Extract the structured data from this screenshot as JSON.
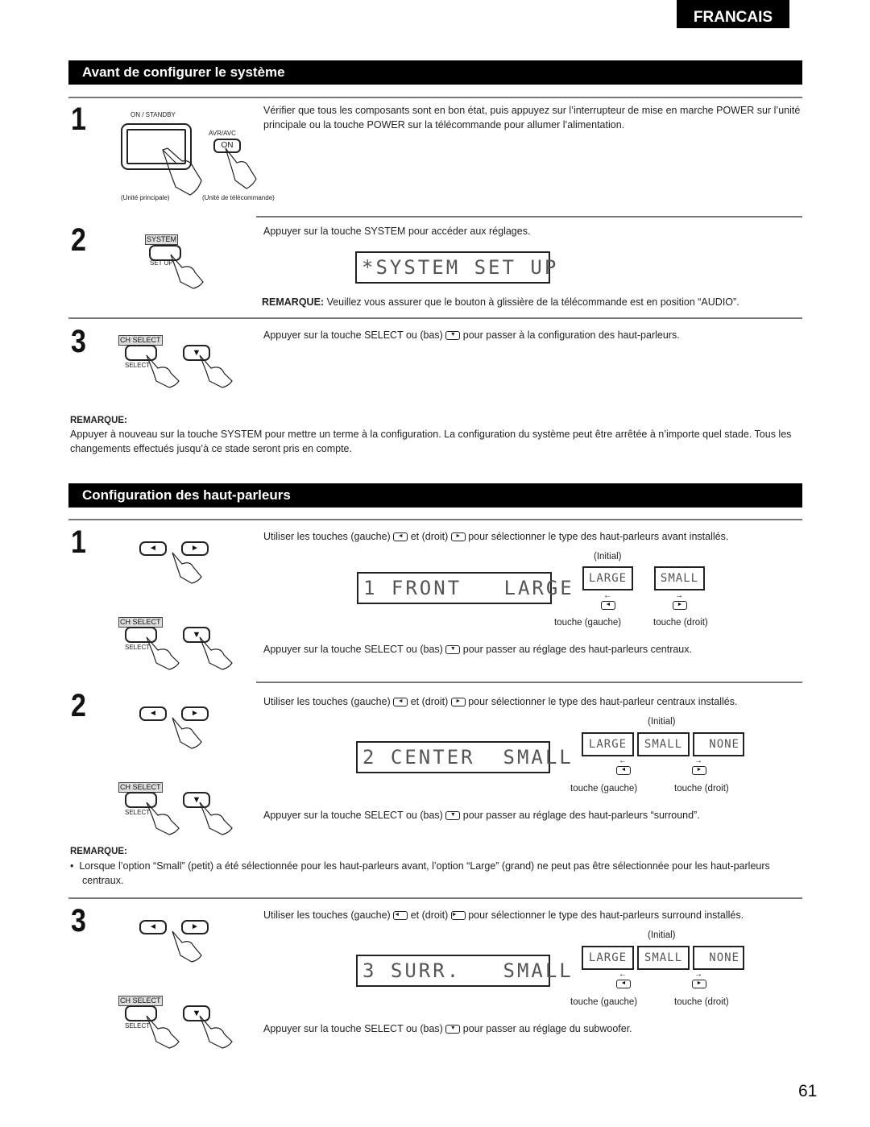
{
  "language_tab": "FRANCAIS",
  "page_number": "61",
  "section1": {
    "title": "Avant de configurer le système",
    "step1": {
      "number": "1",
      "label_on_standby": "ON / STANDBY",
      "label_avr_avc": "AVR/AVC",
      "label_on": "ON",
      "caption_main": "(Unité principale)",
      "caption_remote": "(Unité de télécommande)",
      "text": "Vérifier que tous les composants sont en bon état, puis appuyez sur l’interrupteur de mise en marche POWER sur l’unité principale ou la touche POWER sur la télécommande pour allumer l’alimentation."
    },
    "step2": {
      "number": "2",
      "label_system": "SYSTEM",
      "label_setup": "SET UP",
      "text": "Appuyer sur la touche SYSTEM pour accéder aux réglages.",
      "display": "*SYSTEM SET UP",
      "note_label": "REMARQUE:",
      "note_text": " Veuillez vous assurer que le bouton à glissière de la télécommande est en position “AUDIO”."
    },
    "step3": {
      "number": "3",
      "label_ch_select": "CH SELECT",
      "label_select": "SELECT",
      "text_before": "Appuyer sur la touche SELECT ou (bas)",
      "text_after": "pour passer à la configuration des haut-parleurs."
    },
    "remarque": {
      "title": "REMARQUE:",
      "text": "Appuyer à nouveau sur la touche SYSTEM pour mettre un terme à la configuration. La configuration du système peut être arrêtée à n’importe quel stade. Tous les changements effectués jusqu’à ce stade seront pris en compte."
    }
  },
  "section2": {
    "title": "Configuration des haut-parleurs",
    "step1": {
      "number": "1",
      "text_a": "Utiliser les touches (gauche)",
      "text_b": "et (droit)",
      "text_c": "pour sélectionner le type des haut-parleurs avant installés.",
      "initial": "(Initial)",
      "display": "1 FRONT   LARGE",
      "options": [
        "LARGE",
        "SMALL"
      ],
      "key_left": "touche (gauche)",
      "key_right": "touche (droit)",
      "label_ch_select": "CH SELECT",
      "label_select": "SELECT",
      "select_text_before": "Appuyer sur la touche SELECT ou (bas)",
      "select_text_after": "pour passer au réglage des haut-parleurs centraux."
    },
    "step2": {
      "number": "2",
      "text_a": "Utiliser les touches (gauche)",
      "text_b": "et (droit)",
      "text_c": "pour sélectionner le type des haut-parleur centraux installés.",
      "initial": "(Initial)",
      "display": "2 CENTER  SMALL",
      "options": [
        "LARGE",
        "SMALL",
        " NONE"
      ],
      "key_left": "touche (gauche)",
      "key_right": "touche (droit)",
      "label_ch_select": "CH SELECT",
      "label_select": "SELECT",
      "select_text_before": "Appuyer sur la touche SELECT ou (bas)",
      "select_text_after": "pour passer au réglage des haut-parleurs “surround”."
    },
    "remarque": {
      "title": "REMARQUE:",
      "bullet": "Lorsque l’option “Small” (petit) a été sélectionnée pour les haut-parleurs avant, l’option “Large” (grand) ne peut pas être sélectionnée pour les haut-parleurs centraux."
    },
    "step3": {
      "number": "3",
      "text_a": "Utiliser les touches (gauche)",
      "text_b": "et (droit)",
      "text_c": "pour sélectionner le type des haut-parleurs surround installés.",
      "initial": "(Initial)",
      "display": "3 SURR.   SMALL",
      "options": [
        "LARGE",
        "SMALL",
        " NONE"
      ],
      "key_left": "touche (gauche)",
      "key_right": "touche (droit)",
      "label_ch_select": "CH SELECT",
      "label_select": "SELECT",
      "select_text_before": "Appuyer sur la touche SELECT ou (bas)",
      "select_text_after": "pour passer au réglage du subwoofer."
    }
  },
  "icons": {
    "left": "◄",
    "right": "►",
    "down": "▼",
    "arrow_left": "←",
    "arrow_right": "→"
  }
}
